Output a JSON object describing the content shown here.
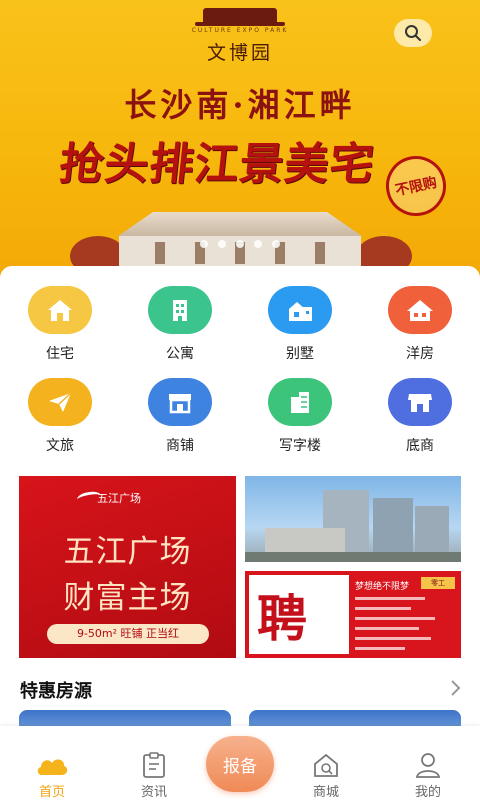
{
  "header": {
    "logo_en": "CULTURE EXPO PARK",
    "logo_cn": "文博园",
    "search_icon": "search-icon"
  },
  "banner": {
    "line1": "长沙南·湘江畔",
    "line2": "抢头排江景美宅",
    "stamp": "不限购",
    "slides": 5
  },
  "categories": [
    {
      "label": "住宅",
      "icon": "house-icon",
      "color": "#f6c743"
    },
    {
      "label": "公寓",
      "icon": "apartment-icon",
      "color": "#3cc48d"
    },
    {
      "label": "别墅",
      "icon": "villa-icon",
      "color": "#2a9bf0"
    },
    {
      "label": "洋房",
      "icon": "western-house-icon",
      "color": "#f0603a"
    },
    {
      "label": "文旅",
      "icon": "paper-plane-icon",
      "color": "#f4b21e"
    },
    {
      "label": "商铺",
      "icon": "shop-icon",
      "color": "#3f83e0"
    },
    {
      "label": "写字楼",
      "icon": "office-building-icon",
      "color": "#3cc47a"
    },
    {
      "label": "底商",
      "icon": "storefront-icon",
      "color": "#4f6ee0"
    }
  ],
  "promo": {
    "brand": "五江广场",
    "title1": "五江广场",
    "title2": "财富主场",
    "pill": "9-50m² 旺铺  正当红",
    "hire_char": "聘",
    "hire_head": "梦想绝不限梦",
    "hire_badge": "零工"
  },
  "special": {
    "title": "特惠房源"
  },
  "tabbar": {
    "home": "首页",
    "news": "资讯",
    "report": "报备",
    "mall": "商城",
    "mine": "我的"
  },
  "colors": {
    "accent": "#f2a20f",
    "report": "#f08a56",
    "banner": "#f9c21a"
  }
}
